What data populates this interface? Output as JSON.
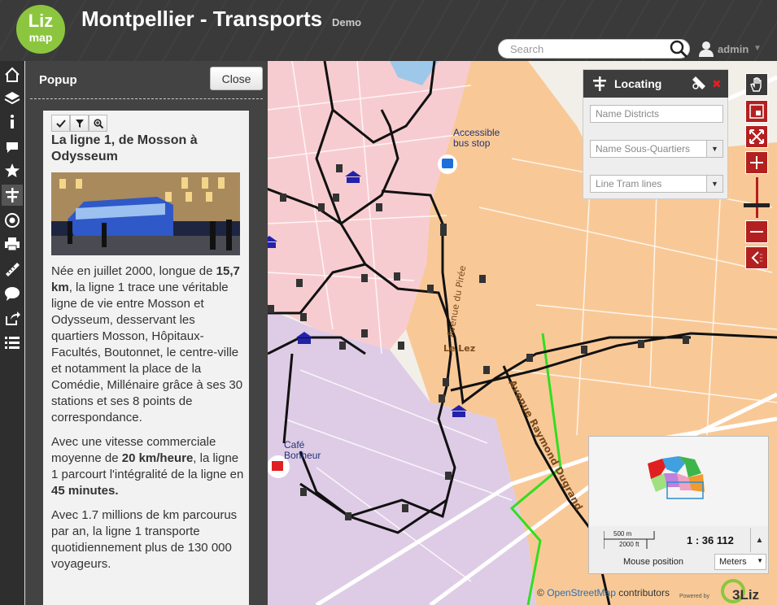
{
  "header": {
    "logo_line1": "Liz",
    "logo_line2": "map",
    "title": "Montpellier - Transports",
    "subtitle": "Demo",
    "search_placeholder": "Search",
    "user_name": "admin",
    "icons": [
      "search-icon",
      "user-icon",
      "chevron-down-icon"
    ]
  },
  "toolbar": {
    "items": [
      "home-icon",
      "layers-icon",
      "info-icon",
      "comment-icon",
      "star-icon",
      "locate-icon",
      "target-icon",
      "print-icon",
      "measure-icon",
      "chat-icon",
      "share-icon",
      "list-icon"
    ]
  },
  "popup": {
    "title": "Popup",
    "close_label": "Close",
    "buttons": [
      "check-icon",
      "filter-icon",
      "zoom-icon"
    ],
    "feature_title": "La ligne 1, de Mosson à Odysseum",
    "para1_a": "Née en juillet 2000, longue de ",
    "para1_b": "15,7 km",
    "para1_c": ", la ligne 1 trace une véritable ligne de vie entre Mosson et Odysseum, desservant les quartiers Mosson, Hôpitaux-Facultés, Boutonnet, le centre-ville et notamment la place de la Comédie, Millénaire grâce à ses 30 stations et ses 8 points de correspondance.",
    "para2_a": "Avec une vitesse commerciale moyenne de ",
    "para2_b": "20 km/heure",
    "para2_c": ", la ligne 1 parcourt l'intégralité de la ligne en ",
    "para2_d": "45 minutes.",
    "para3": "Avec 1.7 millions de km parcourus par an, la ligne 1 transporte quotidiennement plus de 130 000 voyageurs."
  },
  "map": {
    "labels": {
      "bus_stop": "Accessible bus stop",
      "cafe": "Café Bonheur",
      "street1": "Avenue du Pirée",
      "street2": "Avenue Raymond Dugrand",
      "river": "Le Lez"
    },
    "colors": {
      "pink": "#f7c9cf",
      "orange": "#f8c48e",
      "purple": "#dcc9e6",
      "tram": "#111111",
      "green": "#33dd22"
    }
  },
  "locating": {
    "title": "Locating",
    "field1": "Name Districts",
    "field2": "Name Sous-Quartiers",
    "field3": "Line Tram lines",
    "icons": [
      "locating-icon",
      "clear-tool-icon",
      "close-icon"
    ]
  },
  "nav": [
    "pan-icon",
    "zoom-box-icon",
    "zoom-extent-icon",
    "zoom-in-icon",
    "zoom-out-icon",
    "previous-icon"
  ],
  "overview": {
    "scale_m": "500 m",
    "scale_ft": "2000 ft",
    "scale_ratio": "1 : 36 112",
    "mouse_position_label": "Mouse position",
    "units": "Meters"
  },
  "attribution": {
    "prefix": "©",
    "link": "OpenStreetMap",
    "suffix": "contributors",
    "powered": "Powered by",
    "brand": "3Liz"
  }
}
